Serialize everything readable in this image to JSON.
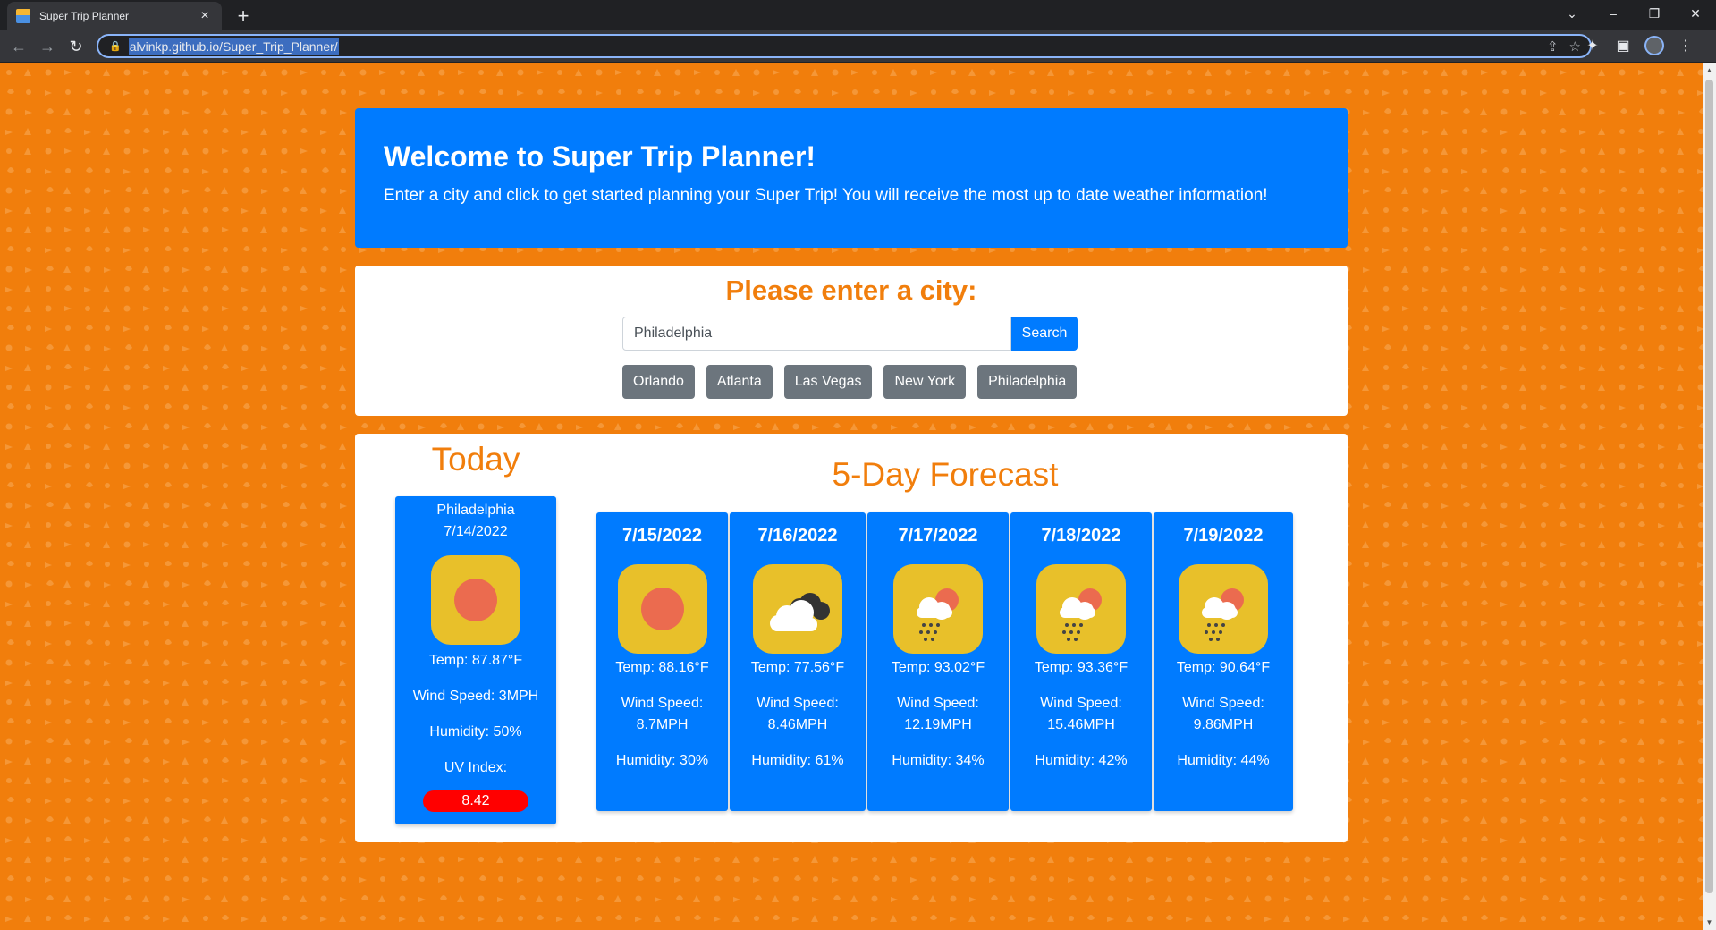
{
  "browser": {
    "tab_title": "Super Trip Planner",
    "url": "alvinkp.github.io/Super_Trip_Planner/"
  },
  "colors": {
    "page_background": "#f17e0c",
    "primary": "#007bff",
    "city_button": "#6c757d",
    "uv_badge": "#ff0000",
    "icon_tile": "#e8c02a"
  },
  "jumbotron": {
    "title": "Welcome to Super Trip Planner!",
    "subtitle": "Enter a city and click to get started planning your Super Trip! You will receive the most up to date weather information!"
  },
  "search": {
    "heading": "Please enter a city:",
    "input_value": "Philadelphia",
    "button_label": "Search",
    "saved_cities": [
      "Orlando",
      "Atlanta",
      "Las Vegas",
      "New York",
      "Philadelphia"
    ]
  },
  "today": {
    "heading": "Today",
    "city": "Philadelphia",
    "date": "7/14/2022",
    "icon": "sun-icon",
    "temp": "Temp: 87.87°F",
    "wind": "Wind Speed: 3MPH",
    "humidity": "Humidity: 50%",
    "uv_label": "UV Index:",
    "uv_value": "8.42"
  },
  "forecast": {
    "heading": "5-Day Forecast",
    "days": [
      {
        "date": "7/15/2022",
        "icon": "sun-icon",
        "temp": "Temp: 88.16°F",
        "wind_label": "Wind Speed:",
        "wind_value": "8.7MPH",
        "humidity": "Humidity: 30%"
      },
      {
        "date": "7/16/2022",
        "icon": "cloudy-icon",
        "temp": "Temp: 77.56°F",
        "wind_label": "Wind Speed:",
        "wind_value": "8.46MPH",
        "humidity": "Humidity: 61%"
      },
      {
        "date": "7/17/2022",
        "icon": "rain-sun-icon",
        "temp": "Temp: 93.02°F",
        "wind_label": "Wind Speed:",
        "wind_value": "12.19MPH",
        "humidity": "Humidity: 34%"
      },
      {
        "date": "7/18/2022",
        "icon": "rain-sun-icon",
        "temp": "Temp: 93.36°F",
        "wind_label": "Wind Speed:",
        "wind_value": "15.46MPH",
        "humidity": "Humidity: 42%"
      },
      {
        "date": "7/19/2022",
        "icon": "rain-sun-icon",
        "temp": "Temp: 90.64°F",
        "wind_label": "Wind Speed:",
        "wind_value": "9.86MPH",
        "humidity": "Humidity: 44%"
      }
    ]
  }
}
